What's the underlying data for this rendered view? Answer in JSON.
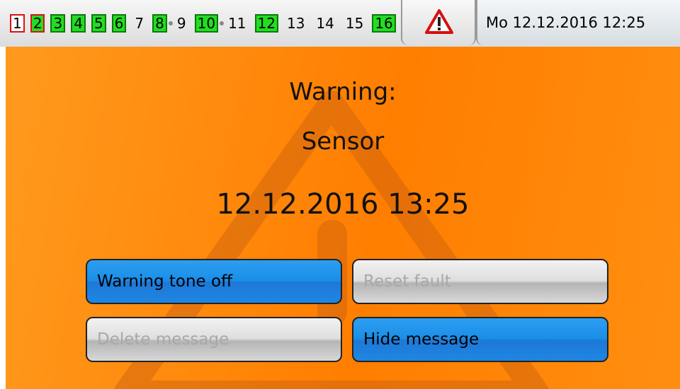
{
  "status_bar": {
    "outputs": [
      {
        "label": "1",
        "state": "off-red"
      },
      {
        "label": "2",
        "state": "on-red"
      },
      {
        "label": "3",
        "state": "on"
      },
      {
        "label": "4",
        "state": "on"
      },
      {
        "label": "5",
        "state": "on"
      },
      {
        "label": "6",
        "state": "on"
      },
      {
        "label": "7",
        "state": "plain"
      },
      {
        "label": "8",
        "state": "on"
      },
      {
        "label": "9",
        "state": "plain"
      },
      {
        "label": "10",
        "state": "on"
      },
      {
        "label": "11",
        "state": "plain"
      },
      {
        "label": "12",
        "state": "on"
      },
      {
        "label": "13",
        "state": "plain"
      },
      {
        "label": "14",
        "state": "plain"
      },
      {
        "label": "15",
        "state": "plain"
      },
      {
        "label": "16",
        "state": "on"
      }
    ],
    "alarm_icon": "warning-triangle-icon",
    "datetime": "Mo 12.12.2016  12:25"
  },
  "message": {
    "title": "Warning:",
    "source": "Sensor",
    "timestamp": "12.12.2016 13:25",
    "background_icon": "warning-triangle-icon"
  },
  "buttons": {
    "warning_tone_off": "Warning tone off",
    "reset_fault": "Reset fault",
    "delete_message": "Delete message",
    "hide_message": "Hide message"
  },
  "colors": {
    "background": "#ff8a0a",
    "button_active": "#1a8ee8",
    "button_disabled": "#d8d8d8",
    "output_on": "#22dd22",
    "output_fault_border": "#e01010"
  }
}
